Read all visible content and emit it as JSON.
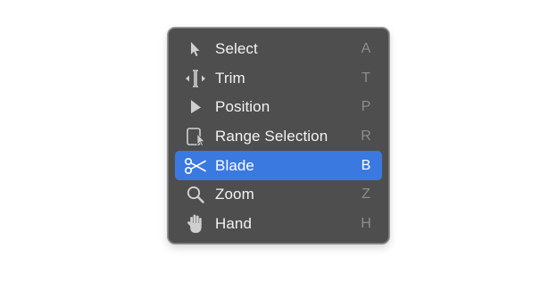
{
  "menu": {
    "items": [
      {
        "label": "Select",
        "shortcut": "A",
        "icon": "arrow-pointer-icon",
        "selected": false
      },
      {
        "label": "Trim",
        "shortcut": "T",
        "icon": "trim-icon",
        "selected": false
      },
      {
        "label": "Position",
        "shortcut": "P",
        "icon": "position-arrow-icon",
        "selected": false
      },
      {
        "label": "Range Selection",
        "shortcut": "R",
        "icon": "range-selection-icon",
        "selected": false
      },
      {
        "label": "Blade",
        "shortcut": "B",
        "icon": "scissors-icon",
        "selected": true
      },
      {
        "label": "Zoom",
        "shortcut": "Z",
        "icon": "magnifier-icon",
        "selected": false
      },
      {
        "label": "Hand",
        "shortcut": "H",
        "icon": "hand-icon",
        "selected": false
      }
    ]
  },
  "colors": {
    "menu_background": "#4e4e4e",
    "highlight": "#3a79e0",
    "label_text": "#f2f2f2",
    "shortcut_text": "#8d8d8d"
  }
}
